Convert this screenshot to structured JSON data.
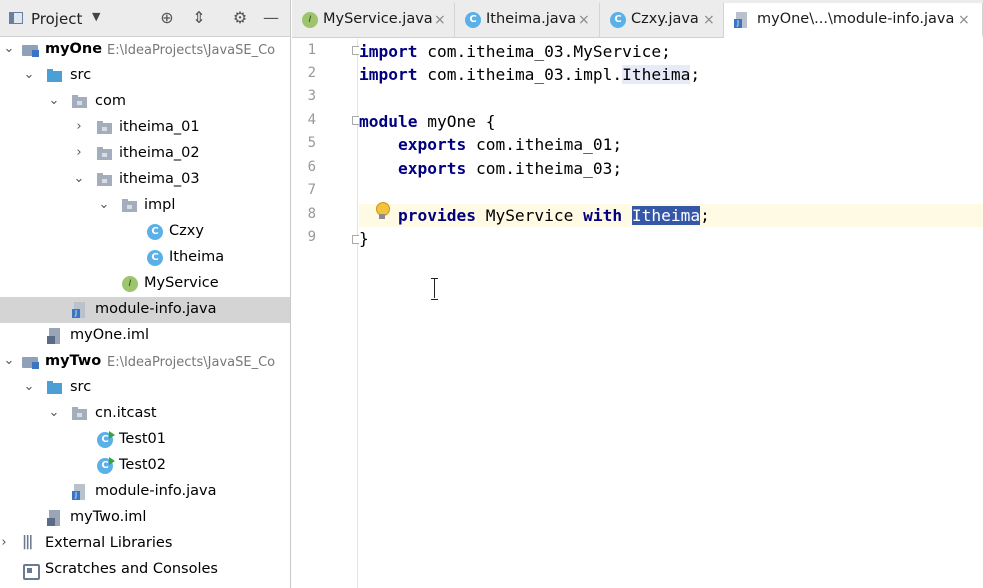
{
  "project_panel": {
    "title": "Project",
    "tools": [
      "locate-icon",
      "collapse-icon",
      "settings-icon",
      "hide-icon"
    ],
    "tree": [
      {
        "label": "myOne",
        "path": "E:\\IdeaProjects\\JavaSE_Co",
        "icon": "module-icon",
        "expanded": true
      },
      {
        "label": "src",
        "icon": "source-folder-icon",
        "expanded": true
      },
      {
        "label": "com",
        "icon": "package-icon",
        "expanded": true
      },
      {
        "label": "itheima_01",
        "icon": "package-icon",
        "expanded": false
      },
      {
        "label": "itheima_02",
        "icon": "package-icon",
        "expanded": false
      },
      {
        "label": "itheima_03",
        "icon": "package-icon",
        "expanded": true
      },
      {
        "label": "impl",
        "icon": "package-icon",
        "expanded": true
      },
      {
        "label": "Czxy",
        "icon": "class-icon"
      },
      {
        "label": "Itheima",
        "icon": "class-icon"
      },
      {
        "label": "MyService",
        "icon": "interface-icon"
      },
      {
        "label": "module-info.java",
        "icon": "java-file-icon",
        "selected": true
      },
      {
        "label": "myOne.iml",
        "icon": "iml-file-icon"
      },
      {
        "label": "myTwo",
        "path": "E:\\IdeaProjects\\JavaSE_Co",
        "icon": "module-icon",
        "expanded": true
      },
      {
        "label": "src",
        "icon": "source-folder-icon",
        "expanded": true
      },
      {
        "label": "cn.itcast",
        "icon": "package-icon",
        "expanded": true
      },
      {
        "label": "Test01",
        "icon": "main-class-icon"
      },
      {
        "label": "Test02",
        "icon": "main-class-icon"
      },
      {
        "label": "module-info.java",
        "icon": "java-file-icon"
      },
      {
        "label": "myTwo.iml",
        "icon": "iml-file-icon"
      },
      {
        "label": "External Libraries",
        "icon": "libraries-icon",
        "expanded": false
      },
      {
        "label": "Scratches and Consoles",
        "icon": "scratches-icon"
      }
    ]
  },
  "tabs": [
    {
      "label": "MyService.java",
      "icon": "interface-icon",
      "close": "×"
    },
    {
      "label": "Itheima.java",
      "icon": "class-icon",
      "close": "×"
    },
    {
      "label": "Czxy.java",
      "icon": "class-icon",
      "close": "×"
    },
    {
      "label": "myOne\\...\\module-info.java",
      "icon": "java-file-icon",
      "close": "×",
      "active": true
    }
  ],
  "editor": {
    "line_numbers": [
      "1",
      "2",
      "3",
      "4",
      "5",
      "6",
      "7",
      "8",
      "9"
    ],
    "lines": [
      {
        "kw": "import",
        "rest": " com.itheima_03.MyService;"
      },
      {
        "kw": "import",
        "rest": " com.itheima_03.impl.",
        "soft": "Itheima",
        "tail": ";"
      },
      {},
      {
        "kw": "module",
        "rest": " myOne {"
      },
      {
        "indent": "    ",
        "kw": "exports",
        "rest": " com.itheima_01;"
      },
      {
        "indent": "    ",
        "kw": "exports",
        "rest": " com.itheima_03;"
      },
      {},
      {
        "indent": "    ",
        "kw": "provides",
        "rest": " MyService ",
        "kw2": "with",
        "sp": " ",
        "sel": "Itheima",
        "tail": ";"
      },
      {
        "rest": "}"
      }
    ],
    "current_line": "8",
    "intention_icon": "lightbulb-icon"
  }
}
